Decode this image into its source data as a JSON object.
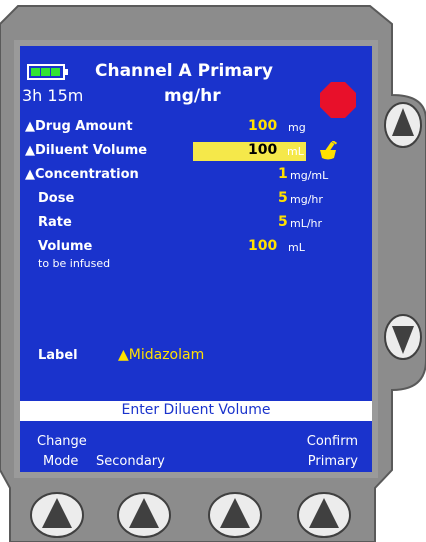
{
  "header": {
    "channel_title": "Channel A Primary",
    "time_remaining": "3h 15m",
    "dose_unit": "mg/hr"
  },
  "rows": [
    {
      "label": "▲Drug Amount",
      "value": "100",
      "unit": "mg"
    },
    {
      "label": "▲Diluent Volume",
      "value": "100",
      "unit": "mL"
    },
    {
      "label": "▲Concentration",
      "value": "1",
      "unit": "mg/mL"
    },
    {
      "label": "Dose",
      "value": "5",
      "unit": "mg/hr"
    },
    {
      "label": "Rate",
      "value": "5",
      "unit": "mL/hr"
    },
    {
      "label": "Volume",
      "value": "100",
      "unit": "mL"
    }
  ],
  "volume_sublabel": "to be infused",
  "drug_label": {
    "label": "Label",
    "value": "▲Midazolam"
  },
  "status_message": "Enter Diluent Volume",
  "softkeys": {
    "change_mode_line1": "Change",
    "change_mode_line2": "Mode",
    "secondary": "Secondary",
    "confirm_line1": "Confirm",
    "confirm_line2": "Primary"
  },
  "colors": {
    "screen_bg": "#1a33cc",
    "value_yellow": "#ffe000",
    "highlight": "#f5e84a",
    "stop_red": "#e8102a",
    "battery_green": "#33e633",
    "bezel": "#8c8c8c"
  },
  "icons": [
    "battery-icon",
    "stop-icon",
    "syringe-mixing-icon",
    "up-arrow-icon",
    "down-arrow-icon"
  ]
}
